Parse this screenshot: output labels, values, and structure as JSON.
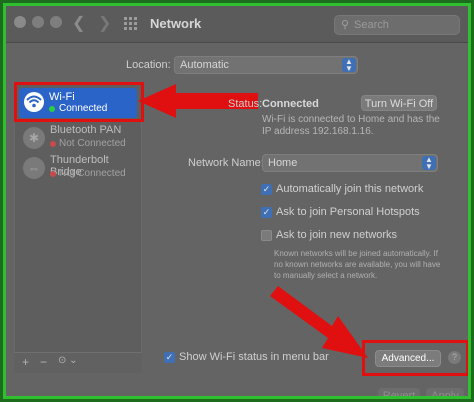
{
  "window": {
    "title": "Network",
    "search_placeholder": "Search"
  },
  "location": {
    "label": "Location:",
    "value": "Automatic"
  },
  "sidebar": {
    "items": [
      {
        "name": "Wi-Fi",
        "status": "Connected",
        "selected": true,
        "status_color": "#2ecc40"
      },
      {
        "name": "Bluetooth PAN",
        "status": "Not Connected",
        "status_color": "#d03b3b"
      },
      {
        "name": "Thunderbolt Bridge",
        "status": "Not Connected",
        "status_color": "#d03b3b"
      }
    ],
    "tools": [
      "+",
      "−",
      "⊙ ⌄"
    ]
  },
  "detail": {
    "status_label": "Status:",
    "status_value": "Connected",
    "turn_off_label": "Turn Wi-Fi Off",
    "status_desc": "Wi-Fi is connected to Home and has the IP address 192.168.1.16.",
    "network_name_label": "Network Name:",
    "network_name_value": "Home",
    "options": [
      {
        "label": "Automatically join this network",
        "checked": true
      },
      {
        "label": "Ask to join Personal Hotspots",
        "checked": true
      },
      {
        "label": "Ask to join new networks",
        "checked": false
      }
    ],
    "new_networks_note": "Known networks will be joined automatically. If no known networks are available, you will have to manually select a network."
  },
  "footer": {
    "show_wifi_label": "Show Wi-Fi status in menu bar",
    "advanced_label": "Advanced...",
    "help_label": "?",
    "revert_label": "Revert",
    "apply_label": "Apply"
  },
  "colors": {
    "highlight": "#e01010",
    "frame": "#2fbf2f",
    "selection": "#2a64c8"
  }
}
